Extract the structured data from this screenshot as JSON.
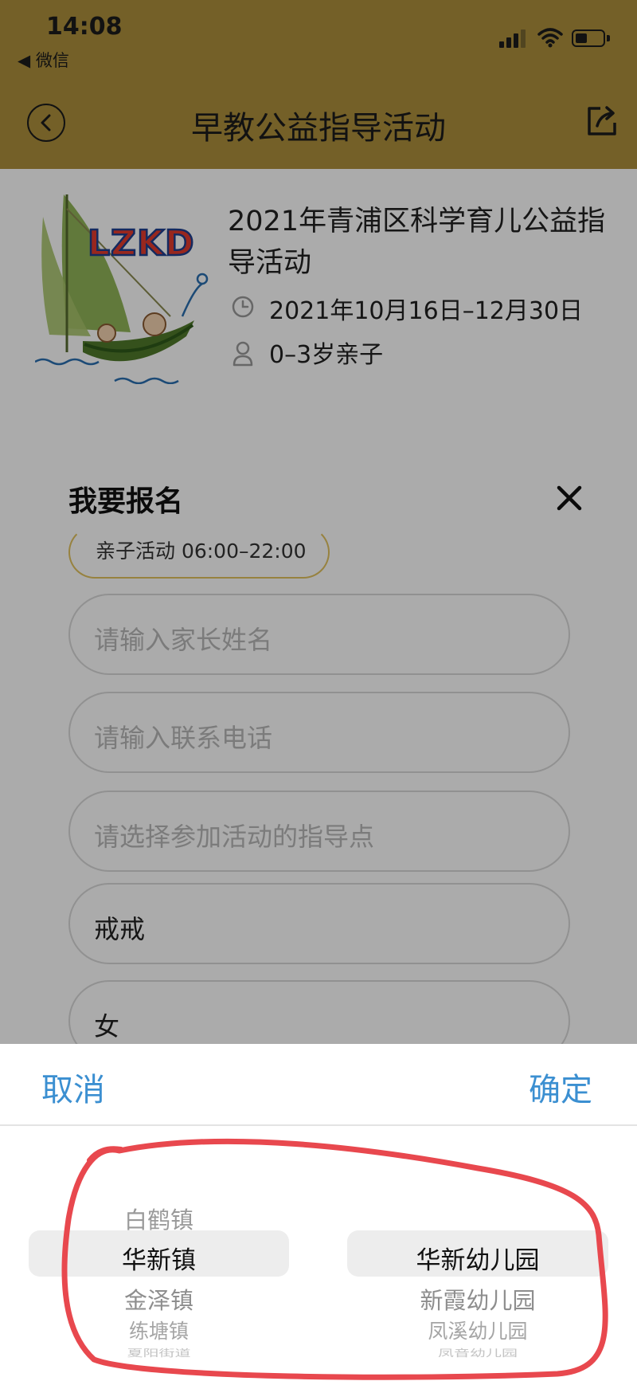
{
  "status_bar": {
    "time": "14:08",
    "back_app": "◀ 微信"
  },
  "header": {
    "title": "早教公益指导活动"
  },
  "activity": {
    "title": "2021年青浦区科学育儿公益指导活动",
    "date_range": "2021年10月16日–12月30日",
    "age_group": "0–3岁亲子",
    "logo_text": "LZKD"
  },
  "signup": {
    "title": "我要报名",
    "session_chip": "亲子活动  06:00–22:00",
    "fields": {
      "parent_name_placeholder": "请输入家长姓名",
      "phone_placeholder": "请输入联系电话",
      "location_placeholder": "请选择参加活动的指导点",
      "child_name_value": "戒戒",
      "gender_value": "女"
    }
  },
  "picker": {
    "cancel_label": "取消",
    "confirm_label": "确定",
    "left_column": [
      "白鹤镇",
      "华新镇",
      "金泽镇",
      "练塘镇",
      "夏阳街道"
    ],
    "right_column": [
      "华新幼儿园",
      "新霞幼儿园",
      "凤溪幼儿园",
      "凤音幼儿园"
    ],
    "left_selected": "华新镇",
    "right_selected": "华新幼儿园"
  },
  "colors": {
    "header": "#ad8f3c",
    "accent_blue": "#3b8fd1",
    "chip_border": "#e2c25f",
    "annotation": "#e8484e"
  }
}
